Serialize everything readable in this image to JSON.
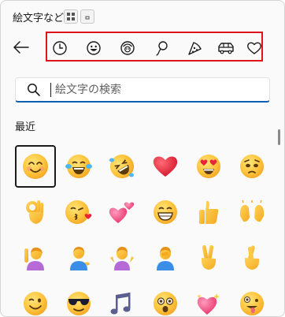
{
  "window": {
    "title": "絵文字など",
    "icons": [
      "grid-icon",
      "small-window-icon"
    ]
  },
  "nav": {
    "back_icon": "back-arrow-icon",
    "categories": [
      {
        "id": "recent",
        "icon": "clock-icon"
      },
      {
        "id": "smileys",
        "icon": "smiley-icon"
      },
      {
        "id": "people",
        "icon": "people-icon"
      },
      {
        "id": "celebration",
        "icon": "balloon-icon"
      },
      {
        "id": "food",
        "icon": "pizza-icon"
      },
      {
        "id": "travel",
        "icon": "car-icon"
      },
      {
        "id": "symbols",
        "icon": "heart-icon"
      }
    ],
    "highlight_color": "#e0141c"
  },
  "search": {
    "placeholder": "絵文字の検索",
    "value": "",
    "icon": "search-icon",
    "accent": "#0a5fb4"
  },
  "section": {
    "label": "最近"
  },
  "emojis": [
    [
      "smiling-face",
      "tears-of-joy",
      "rolling-on-floor",
      "red-heart",
      "heart-eyes",
      "pleading-face"
    ],
    [
      "ok-hand",
      "kissing-face",
      "two-hearts",
      "grinning-face",
      "thumbs-up",
      "raising-hands"
    ],
    [
      "person-raising-hand",
      "person-tipping-hand",
      "person-shrugging",
      "person-facepalming",
      "victory-hand",
      "crossed-fingers"
    ],
    [
      "winking-face",
      "sunglasses-face",
      "musical-notes",
      "astonished-face",
      "sparkling-heart",
      "zany-face"
    ]
  ],
  "selected_emoji": "smiling-face"
}
